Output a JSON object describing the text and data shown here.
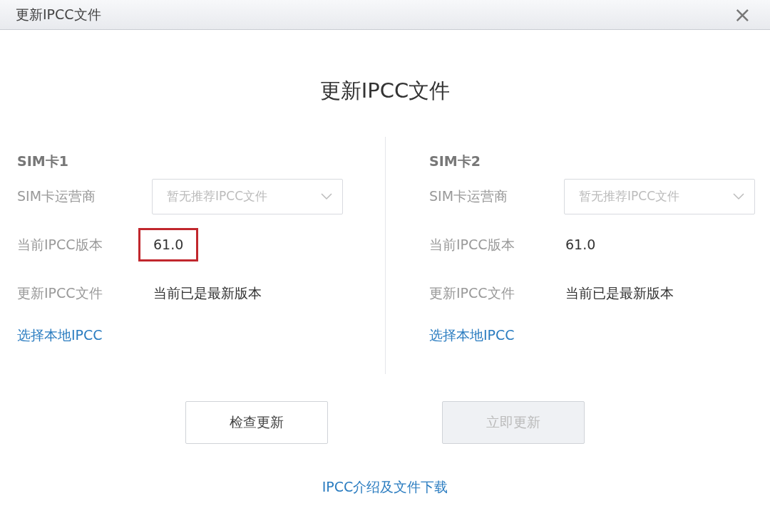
{
  "window": {
    "title": "更新IPCC文件",
    "close": "×"
  },
  "heading": "更新IPCC文件",
  "sims": [
    {
      "title": "SIM卡1",
      "carrier_label": "SIM卡运营商",
      "carrier_select": {
        "placeholder": "暂无推荐IPCC文件",
        "disabled": true
      },
      "version_label": "当前IPCC版本",
      "version": "61.0",
      "version_highlighted": true,
      "update_label": "更新IPCC文件",
      "update_status": "当前已是最新版本",
      "local_link": "选择本地IPCC"
    },
    {
      "title": "SIM卡2",
      "carrier_label": "SIM卡运营商",
      "carrier_select": {
        "placeholder": "暂无推荐IPCC文件",
        "disabled": true
      },
      "version_label": "当前IPCC版本",
      "version": "61.0",
      "version_highlighted": false,
      "update_label": "更新IPCC文件",
      "update_status": "当前已是最新版本",
      "local_link": "选择本地IPCC"
    }
  ],
  "buttons": [
    {
      "label": "检查更新",
      "disabled": false
    },
    {
      "label": "立即更新",
      "disabled": true
    }
  ],
  "footer_link": "IPCC介绍及文件下载"
}
